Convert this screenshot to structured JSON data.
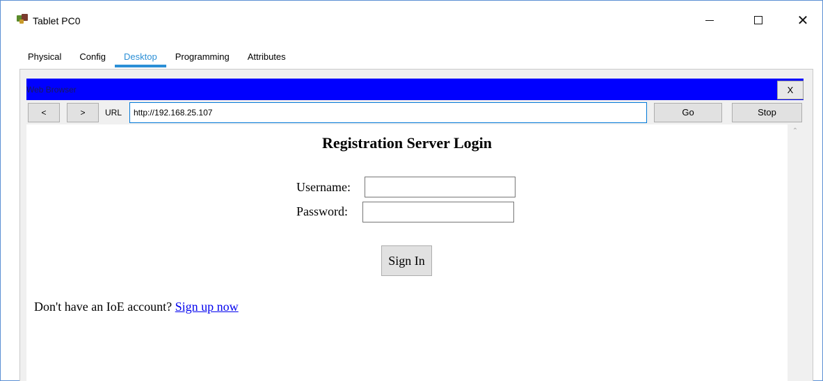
{
  "window": {
    "title": "Tablet PC0",
    "controls": {
      "minimize": "—",
      "maximize": "☐",
      "close": "✕"
    }
  },
  "tabs": [
    {
      "label": "Physical",
      "active": false
    },
    {
      "label": "Config",
      "active": false
    },
    {
      "label": "Desktop",
      "active": true
    },
    {
      "label": "Programming",
      "active": false
    },
    {
      "label": "Attributes",
      "active": false
    }
  ],
  "browser": {
    "title": "Web Browser",
    "close_label": "X",
    "back_label": "<",
    "forward_label": ">",
    "url_label": "URL",
    "url_value": "http://192.168.25.107",
    "go_label": "Go",
    "stop_label": "Stop"
  },
  "page": {
    "title": "Registration Server Login",
    "username_label": "Username:",
    "username_value": "",
    "password_label": "Password:",
    "password_value": "",
    "signin_label": "Sign In",
    "signup_prompt": "Don't have an IoE account? ",
    "signup_link": "Sign up now"
  },
  "colors": {
    "accent": "#2b8fd6",
    "browser_header": "#0000ff",
    "link": "#0000ee"
  },
  "icons": {
    "app": "packet-tracer-icon",
    "scroll_up": "chevron-up-icon"
  }
}
